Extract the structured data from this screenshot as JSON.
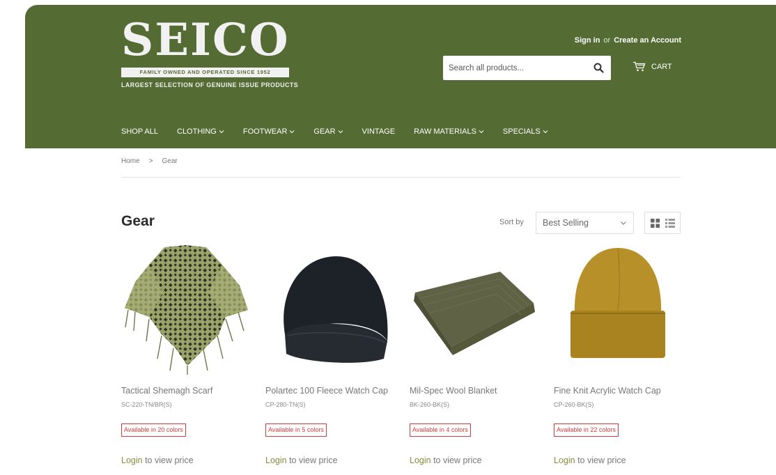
{
  "colors": {
    "header_bg": "#546c34",
    "badge": "#d23b3b",
    "link": "#8a8c3e"
  },
  "brand": {
    "name": "SEICO",
    "band": "FAMILY OWNED AND OPERATED SINCE 1952",
    "tagline": "LARGEST SELECTION OF GENUINE ISSUE PRODUCTS"
  },
  "account": {
    "sign_in": "Sign in",
    "or": "or",
    "create": "Create an Account"
  },
  "search": {
    "placeholder": "Search all products..."
  },
  "cart": {
    "label": "CART"
  },
  "nav": [
    {
      "label": "SHOP ALL",
      "dropdown": false
    },
    {
      "label": "CLOTHING",
      "dropdown": true
    },
    {
      "label": "FOOTWEAR",
      "dropdown": true
    },
    {
      "label": "GEAR",
      "dropdown": true
    },
    {
      "label": "VINTAGE",
      "dropdown": false
    },
    {
      "label": "RAW MATERIALS",
      "dropdown": true
    },
    {
      "label": "SPECIALS",
      "dropdown": true
    }
  ],
  "breadcrumb": {
    "home": "Home",
    "sep": ">",
    "current": "Gear"
  },
  "page": {
    "title": "Gear",
    "sort_label": "Sort by",
    "sort_value": "Best Selling"
  },
  "products": [
    {
      "title": "Tactical Shemagh Scarf",
      "sku": "SC-220-TN/BR(S)",
      "badge": "Available in 20 colors",
      "login": "Login",
      "price_text": "to view price"
    },
    {
      "title": "Polartec 100 Fleece Watch Cap",
      "sku": "CP-280-TN(S)",
      "badge": "Available in 5 colors",
      "login": "Login",
      "price_text": "to view price"
    },
    {
      "title": "Mil-Spec Wool Blanket",
      "sku": "BK-260-BK(S)",
      "badge": "Available in 4 colors",
      "login": "Login",
      "price_text": "to view price"
    },
    {
      "title": "Fine Knit Acrylic Watch Cap",
      "sku": "CP-260-BK(S)",
      "badge": "Available in 22 colors",
      "login": "Login",
      "price_text": "to view price"
    }
  ]
}
